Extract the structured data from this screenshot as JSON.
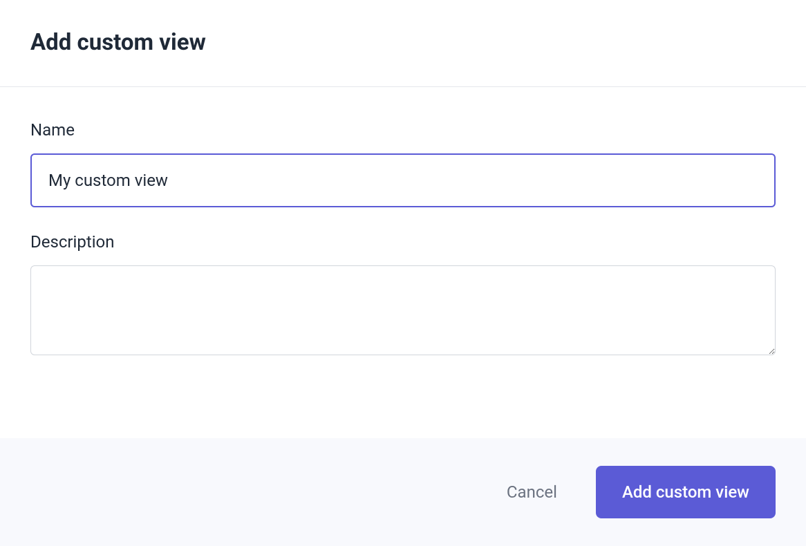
{
  "header": {
    "title": "Add custom view"
  },
  "form": {
    "name": {
      "label": "Name",
      "value": "My custom view"
    },
    "description": {
      "label": "Description",
      "value": ""
    }
  },
  "footer": {
    "cancel_label": "Cancel",
    "submit_label": "Add custom view"
  }
}
